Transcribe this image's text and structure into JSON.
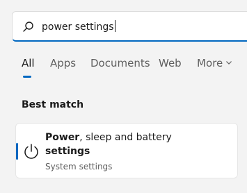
{
  "search": {
    "value": "power settings"
  },
  "tabs": [
    {
      "label": "All",
      "active": true
    },
    {
      "label": "Apps",
      "active": false
    },
    {
      "label": "Documents",
      "active": false
    },
    {
      "label": "Web",
      "active": false
    },
    {
      "label": "More",
      "active": false
    }
  ],
  "section": {
    "title": "Best match"
  },
  "result": {
    "title_bold_1": "Power",
    "title_rest_1": ", sleep and battery",
    "title_bold_2": "settings",
    "subtitle": "System settings",
    "icon": "power-icon"
  },
  "colors": {
    "accent": "#0067c0",
    "background": "#f3f3f3"
  }
}
